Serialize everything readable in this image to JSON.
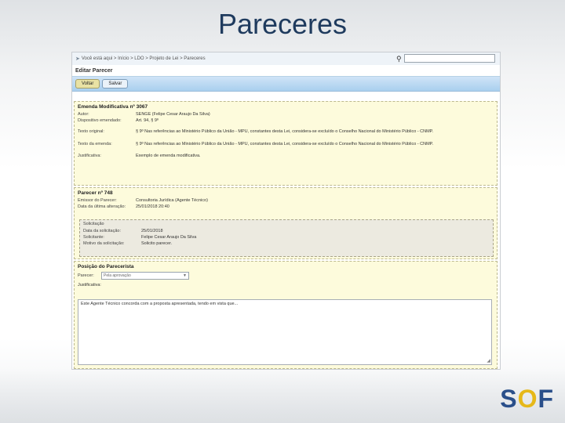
{
  "slide": {
    "title": "Pareceres"
  },
  "app": {
    "breadcrumb": "Você está aqui > Início > LDO > Projeto de Lei > Pareceres",
    "search": {
      "value": ""
    },
    "page_heading": "Editar Parecer",
    "toolbar": {
      "back_label": "Voltar",
      "save_label": "Salvar"
    }
  },
  "emenda": {
    "title": "Emenda Modificativa nº 3067",
    "rows": [
      {
        "label": "Autor:",
        "value": "SENGE (Felipe Cesar Araujo Da Silva)"
      },
      {
        "label": "Dispositivo emendado:",
        "value": "Art. 94, § 9º"
      },
      {
        "label": "Texto original:",
        "value": "§ 9º Nas referências ao Ministério Público da União - MPU, constantes desta Lei, considera-se excluído o Conselho Nacional do Ministério Público - CNMP."
      },
      {
        "label": "Texto da emenda:",
        "value": "§ 9º Nas referências ao Ministério Público da União - MPU, constantes desta Lei, considera-se excluído o Conselho Nacional do Ministério Público - CNMP."
      },
      {
        "label": "Justificativa:",
        "value": "Exemplo de emenda modificativa."
      }
    ]
  },
  "parecer": {
    "title": "Parecer nº 748",
    "rows": [
      {
        "label": "Emissor do Parecer:",
        "value": "Consultoria Jurídica (Agente Técnico)"
      },
      {
        "label": "Data da última alteração:",
        "value": "25/01/2018 20:40"
      }
    ],
    "solicitacao": {
      "title": "Solicitação",
      "rows": [
        {
          "label": "Data da solicitação:",
          "value": "25/01/2018"
        },
        {
          "label": "Solicitante:",
          "value": "Felipe Cesar Araujo Da Silva"
        },
        {
          "label": "Motivo da solicitação:",
          "value": "Solicito parecer."
        }
      ]
    }
  },
  "posicao": {
    "title": "Posição do Parecerista",
    "parecer_label": "Parecer:",
    "parecer_value": "Pela aprovação",
    "justificativa_label": "Justificativa:",
    "justificativa_value": "Este Agente Técnico concorda com a proposta apresentada, tendo em vista que..."
  },
  "footer": {
    "logo": "SOF"
  }
}
